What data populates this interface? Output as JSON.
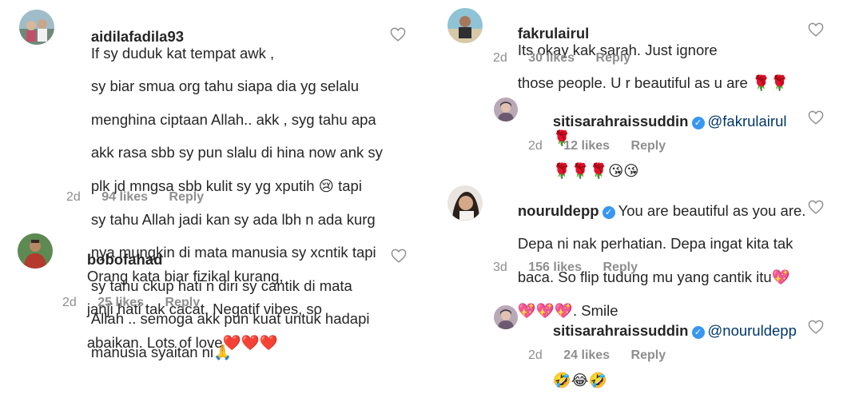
{
  "left": [
    {
      "username": "aidilafadila93",
      "text_lines": [
        "If sy duduk kat tempat awk ,",
        "sy biar smua org tahu siapa dia yg selalu",
        "menghina ciptaan Allah.. akk , syg tahu apa",
        "akk rasa sbb sy pun slalu di hina now ank sy",
        "plk jd mngsa sbb kulit sy yg xputih 😢 tapi",
        "sy tahu Allah jadi kan sy ada lbh n ada kurg",
        "nya mungkin di mata manusia sy xcntik tapi",
        "sy tahu ckup hati n diri sy cantik di mata",
        "Allah .. semoga akk pun kuat untuk hadapi",
        "manusia syaitan ni🙏"
      ],
      "time": "2d",
      "likes": "94 likes",
      "reply": "Reply"
    },
    {
      "username": "bobofahad",
      "text_lines": [
        "Orang kata biar fizikal kurang,",
        "janji hati tak cacat. Negatif vibes, so",
        "abaikan. Lots of love❤️❤️❤️"
      ],
      "time": "2d",
      "likes": "25 likes",
      "reply": "Reply"
    }
  ],
  "right": [
    {
      "username": "fakrulairul",
      "text_lines": [
        "Its okay kak sarah. Just ignore",
        "those people. U r beautiful as u are 🌹🌹"
      ],
      "time": "2d",
      "likes": "30 likes",
      "reply": "Reply"
    },
    {
      "username": "sitisarahraissuddin",
      "mention": "@fakrulairul",
      "text_lines": [
        "🌹",
        "🌹🌹🌹😘😘"
      ],
      "time": "2d",
      "likes": "12 likes",
      "reply": "Reply"
    },
    {
      "username": "nouruldepp",
      "text_lines": [
        "You are beautiful as you are.",
        "Depa ni nak perhatian. Depa ingat kita tak",
        "baca. So flip tudung mu yang cantik itu💖",
        "💖💖💖. Smile"
      ],
      "time": "3d",
      "likes": "156 likes",
      "reply": "Reply"
    },
    {
      "username": "sitisarahraissuddin",
      "mention": "@nouruldepp",
      "text_lines": [
        "",
        "🤣😂🤣"
      ],
      "time": "2d",
      "likes": "24 likes",
      "reply": "Reply"
    }
  ],
  "colors": {
    "text": "#262626",
    "meta": "#8e8e8e",
    "mention": "#00376b",
    "verified": "#3897f0"
  }
}
